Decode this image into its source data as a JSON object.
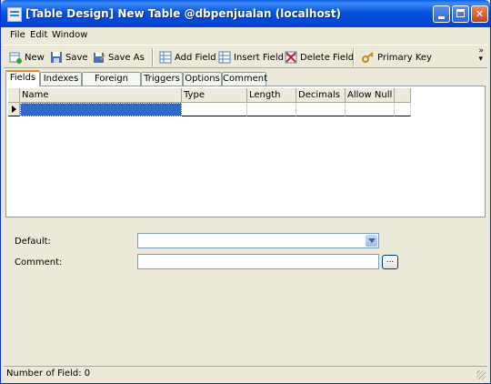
{
  "window": {
    "title": "[Table Design] New Table @dbpenjualan (localhost)"
  },
  "menu": [
    "File",
    "Edit",
    "Window"
  ],
  "toolbar": {
    "new": "New",
    "save": "Save",
    "save_as": "Save As",
    "add_field": "Add Field",
    "insert_field": "Insert Field",
    "delete_field": "Delete Field",
    "primary_key": "Primary Key"
  },
  "tabs": [
    "Fields",
    "Indexes",
    "Foreign Keys",
    "Triggers",
    "Options",
    "Comment"
  ],
  "grid": {
    "columns": [
      "Name",
      "Type",
      "Length",
      "Decimals",
      "Allow Null"
    ]
  },
  "form": {
    "default_label": "Default:",
    "comment_label": "Comment:",
    "default_value": "",
    "comment_value": "",
    "ellipsis": "..."
  },
  "status": {
    "text": "Number of Field: 0"
  },
  "colors": {
    "title_bar": "#0854e1",
    "selection": "#316ac5",
    "face": "#ece9d8"
  }
}
